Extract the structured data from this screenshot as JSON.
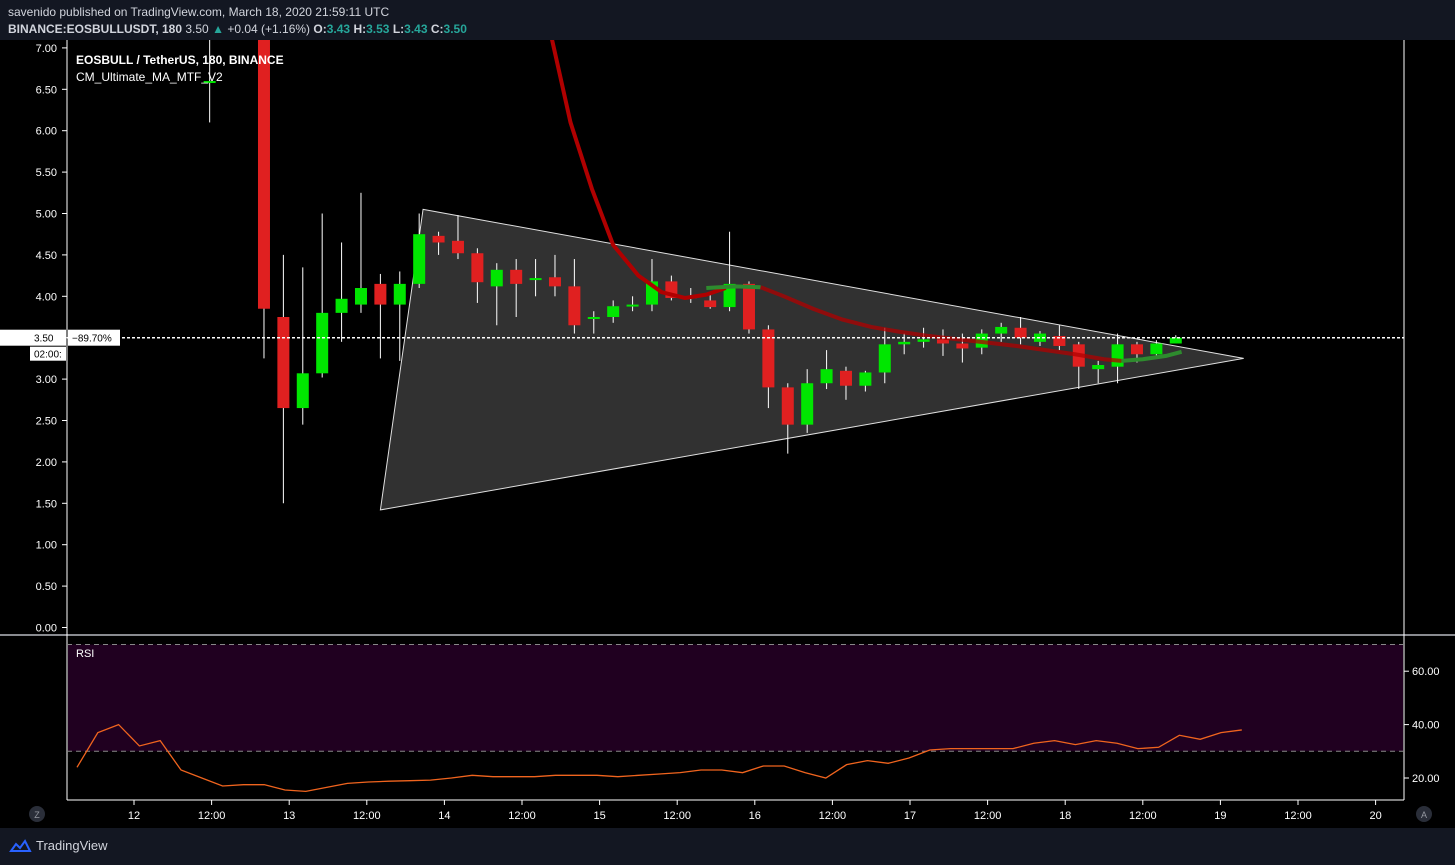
{
  "header": {
    "published_line": "savenido published on TradingView.com, March 18, 2020 21:59:11 UTC",
    "symbol": "BINANCE:EOSBULLUSDT, 180",
    "last": "3.50",
    "change": "+0.04 (+1.16%)",
    "o_label": "O:",
    "o": "3.43",
    "h_label": "H:",
    "h": "3.53",
    "l_label": "L:",
    "l": "3.43",
    "c_label": "C:",
    "c": "3.50"
  },
  "legend": {
    "title": "EOSBULL / TetherUS, 180, BINANCE",
    "indicator": "CM_Ultimate_MA_MTF_V2"
  },
  "footer": {
    "brand": "TradingView",
    "z_button": "Z",
    "a_button": "A"
  },
  "colors": {
    "background": "#000000",
    "up": "#00e600",
    "down": "#e02020",
    "ma_down": "#b00000",
    "ma_up": "#2e8b2e",
    "rsi_line": "#f0641e",
    "rsi_band": "#200020",
    "triangle_fill": "#3a3a3a",
    "grid_text": "#ffffff"
  },
  "chart_data": [
    {
      "type": "candlestick",
      "title": "EOSBULL / TetherUS, 180, BINANCE",
      "ylim": [
        0,
        7.15
      ],
      "y_ticks": [
        "0.00",
        "0.50",
        "1.00",
        "1.50",
        "2.00",
        "2.50",
        "3.00",
        "3.50",
        "4.00",
        "4.50",
        "5.00",
        "5.50",
        "6.00",
        "6.50",
        "7.00"
      ],
      "x_tick_labels": [
        "12",
        "12:00",
        "13",
        "12:00",
        "14",
        "12:00",
        "15",
        "12:00",
        "16",
        "12:00",
        "17",
        "12:00",
        "18",
        "12:00",
        "19",
        "12:00",
        "20"
      ],
      "x_tick_index": [
        0,
        4,
        8,
        12,
        16,
        20,
        24,
        28,
        32,
        36,
        40,
        44,
        48,
        52,
        56,
        60,
        64
      ],
      "last_price_label": "3.50",
      "last_change_label": "−89.70%",
      "countdown_label": "02:00:",
      "candles": [
        {
          "i": 3.9,
          "o": 6.6,
          "h": 7.3,
          "l": 6.1,
          "c": 6.6
        },
        {
          "i": 6.7,
          "o": 7.5,
          "h": 7.5,
          "l": 3.25,
          "c": 3.85
        },
        {
          "i": 7.7,
          "o": 3.75,
          "h": 4.5,
          "l": 1.5,
          "c": 2.65
        },
        {
          "i": 8.7,
          "o": 2.65,
          "h": 4.35,
          "l": 2.45,
          "c": 3.07
        },
        {
          "i": 9.7,
          "o": 3.07,
          "h": 5.0,
          "l": 3.02,
          "c": 3.8
        },
        {
          "i": 10.7,
          "o": 3.8,
          "h": 4.65,
          "l": 3.45,
          "c": 3.97
        },
        {
          "i": 11.7,
          "o": 3.9,
          "h": 5.25,
          "l": 3.8,
          "c": 4.1
        },
        {
          "i": 12.7,
          "o": 4.15,
          "h": 4.27,
          "l": 3.25,
          "c": 3.9
        },
        {
          "i": 13.7,
          "o": 3.9,
          "h": 4.3,
          "l": 3.22,
          "c": 4.15
        },
        {
          "i": 14.7,
          "o": 4.15,
          "h": 5.0,
          "l": 4.1,
          "c": 4.75
        },
        {
          "i": 15.7,
          "o": 4.73,
          "h": 4.78,
          "l": 4.5,
          "c": 4.65
        },
        {
          "i": 16.7,
          "o": 4.67,
          "h": 4.98,
          "l": 4.45,
          "c": 4.52
        },
        {
          "i": 17.7,
          "o": 4.52,
          "h": 4.58,
          "l": 3.92,
          "c": 4.17
        },
        {
          "i": 18.7,
          "o": 4.12,
          "h": 4.4,
          "l": 3.65,
          "c": 4.32
        },
        {
          "i": 19.7,
          "o": 4.32,
          "h": 4.45,
          "l": 3.75,
          "c": 4.15
        },
        {
          "i": 20.7,
          "o": 4.2,
          "h": 4.45,
          "l": 4.0,
          "c": 4.22
        },
        {
          "i": 21.7,
          "o": 4.23,
          "h": 4.5,
          "l": 4.0,
          "c": 4.12
        },
        {
          "i": 22.7,
          "o": 4.12,
          "h": 4.45,
          "l": 3.55,
          "c": 3.65
        },
        {
          "i": 23.7,
          "o": 3.73,
          "h": 3.82,
          "l": 3.55,
          "c": 3.75
        },
        {
          "i": 24.7,
          "o": 3.75,
          "h": 3.95,
          "l": 3.68,
          "c": 3.88
        },
        {
          "i": 25.7,
          "o": 3.88,
          "h": 4.0,
          "l": 3.82,
          "c": 3.9
        },
        {
          "i": 26.7,
          "o": 3.9,
          "h": 4.45,
          "l": 3.82,
          "c": 4.18
        },
        {
          "i": 27.7,
          "o": 4.18,
          "h": 4.25,
          "l": 3.95,
          "c": 3.98
        },
        {
          "i": 28.7,
          "o": 4.0,
          "h": 4.1,
          "l": 3.92,
          "c": 3.98
        },
        {
          "i": 29.7,
          "o": 3.95,
          "h": 4.05,
          "l": 3.85,
          "c": 3.87
        },
        {
          "i": 30.7,
          "o": 3.87,
          "h": 4.78,
          "l": 3.82,
          "c": 4.15
        },
        {
          "i": 31.7,
          "o": 4.15,
          "h": 4.18,
          "l": 3.55,
          "c": 3.6
        },
        {
          "i": 32.7,
          "o": 3.6,
          "h": 3.65,
          "l": 2.65,
          "c": 2.9
        },
        {
          "i": 33.7,
          "o": 2.9,
          "h": 2.95,
          "l": 2.1,
          "c": 2.45
        },
        {
          "i": 34.7,
          "o": 2.45,
          "h": 3.12,
          "l": 2.35,
          "c": 2.95
        },
        {
          "i": 35.7,
          "o": 2.95,
          "h": 3.35,
          "l": 2.88,
          "c": 3.12
        },
        {
          "i": 36.7,
          "o": 3.1,
          "h": 3.15,
          "l": 2.75,
          "c": 2.92
        },
        {
          "i": 37.7,
          "o": 2.92,
          "h": 3.1,
          "l": 2.85,
          "c": 3.08
        },
        {
          "i": 38.7,
          "o": 3.08,
          "h": 3.62,
          "l": 2.95,
          "c": 3.42
        },
        {
          "i": 39.7,
          "o": 3.42,
          "h": 3.55,
          "l": 3.3,
          "c": 3.45
        },
        {
          "i": 40.7,
          "o": 3.45,
          "h": 3.62,
          "l": 3.38,
          "c": 3.48
        },
        {
          "i": 41.7,
          "o": 3.48,
          "h": 3.6,
          "l": 3.28,
          "c": 3.43
        },
        {
          "i": 42.7,
          "o": 3.43,
          "h": 3.55,
          "l": 3.2,
          "c": 3.37
        },
        {
          "i": 43.7,
          "o": 3.38,
          "h": 3.6,
          "l": 3.3,
          "c": 3.55
        },
        {
          "i": 44.7,
          "o": 3.55,
          "h": 3.68,
          "l": 3.45,
          "c": 3.63
        },
        {
          "i": 45.7,
          "o": 3.62,
          "h": 3.75,
          "l": 3.42,
          "c": 3.5
        },
        {
          "i": 46.7,
          "o": 3.45,
          "h": 3.58,
          "l": 3.4,
          "c": 3.55
        },
        {
          "i": 47.7,
          "o": 3.52,
          "h": 3.65,
          "l": 3.35,
          "c": 3.4
        },
        {
          "i": 48.7,
          "o": 3.42,
          "h": 3.45,
          "l": 2.88,
          "c": 3.15
        },
        {
          "i": 49.7,
          "o": 3.12,
          "h": 3.22,
          "l": 2.95,
          "c": 3.17
        },
        {
          "i": 50.7,
          "o": 3.15,
          "h": 3.55,
          "l": 2.95,
          "c": 3.42
        },
        {
          "i": 51.7,
          "o": 3.42,
          "h": 3.45,
          "l": 3.2,
          "c": 3.3
        },
        {
          "i": 52.7,
          "o": 3.3,
          "h": 3.47,
          "l": 3.25,
          "c": 3.43
        },
        {
          "i": 53.7,
          "o": 3.43,
          "h": 3.53,
          "l": 3.43,
          "c": 3.5
        }
      ],
      "ma_red": [
        [
          21.5,
          7.15
        ],
        [
          22.5,
          6.1
        ],
        [
          23.6,
          5.3
        ],
        [
          24.7,
          4.62
        ],
        [
          26.0,
          4.25
        ],
        [
          27.2,
          4.05
        ],
        [
          28.4,
          3.98
        ],
        [
          29.5,
          4.02
        ],
        [
          30.5,
          4.1
        ]
      ],
      "ma_green": [
        [
          29.5,
          4.1
        ],
        [
          31.0,
          4.12
        ],
        [
          32.3,
          4.11
        ]
      ],
      "ma_red_2": [
        [
          32.3,
          4.11
        ],
        [
          33.5,
          4.0
        ],
        [
          35.0,
          3.85
        ],
        [
          36.5,
          3.72
        ],
        [
          38.0,
          3.63
        ],
        [
          39.5,
          3.57
        ],
        [
          41.0,
          3.52
        ],
        [
          42.5,
          3.48
        ],
        [
          44.0,
          3.44
        ],
        [
          45.5,
          3.4
        ],
        [
          47.0,
          3.35
        ],
        [
          48.5,
          3.3
        ],
        [
          50.0,
          3.24
        ],
        [
          50.9,
          3.22
        ]
      ],
      "ma_green_2": [
        [
          50.9,
          3.22
        ],
        [
          52.0,
          3.24
        ],
        [
          53.2,
          3.28
        ],
        [
          54.0,
          3.33
        ]
      ],
      "triangle": [
        [
          12.7,
          1.42
        ],
        [
          14.9,
          5.05
        ],
        [
          57.2,
          3.25
        ]
      ],
      "rsi": {
        "label": "RSI",
        "ylim": [
          15,
          70
        ],
        "y_ticks": [
          "20.00",
          "40.00",
          "60.00"
        ],
        "upper_band": 70,
        "lower_band": 30,
        "values": [
          [
            0,
            24
          ],
          [
            1,
            37
          ],
          [
            2,
            40
          ],
          [
            3,
            32
          ],
          [
            4,
            34
          ],
          [
            5,
            23
          ],
          [
            6,
            20
          ],
          [
            7,
            17
          ],
          [
            8,
            17.5
          ],
          [
            9,
            17.5
          ],
          [
            10,
            15.5
          ],
          [
            11,
            15
          ],
          [
            12,
            16.5
          ],
          [
            13,
            18
          ],
          [
            14,
            18.5
          ],
          [
            15,
            18.8
          ],
          [
            16,
            19
          ],
          [
            17,
            19.2
          ],
          [
            18,
            20
          ],
          [
            19,
            21
          ],
          [
            20,
            20.5
          ],
          [
            21,
            20.5
          ],
          [
            22,
            20.5
          ],
          [
            23,
            21
          ],
          [
            24,
            21
          ],
          [
            25,
            21
          ],
          [
            26,
            20.5
          ],
          [
            27,
            21
          ],
          [
            28,
            21.5
          ],
          [
            29,
            22
          ],
          [
            30,
            23
          ],
          [
            31,
            23
          ],
          [
            32,
            22
          ],
          [
            33,
            24.5
          ],
          [
            34,
            24.5
          ],
          [
            35,
            22
          ],
          [
            36,
            20
          ],
          [
            37,
            25
          ],
          [
            38,
            26.5
          ],
          [
            39,
            25.5
          ],
          [
            40,
            27.5
          ],
          [
            41,
            30.5
          ],
          [
            42,
            31
          ],
          [
            43,
            31
          ],
          [
            44,
            31
          ],
          [
            45,
            31
          ],
          [
            46,
            33
          ],
          [
            47,
            34
          ],
          [
            48,
            32.5
          ],
          [
            49,
            34
          ],
          [
            50,
            33
          ],
          [
            51,
            31
          ],
          [
            52,
            31.5
          ],
          [
            53,
            36
          ],
          [
            54,
            34.5
          ],
          [
            55,
            37
          ],
          [
            56,
            38
          ]
        ]
      }
    }
  ]
}
